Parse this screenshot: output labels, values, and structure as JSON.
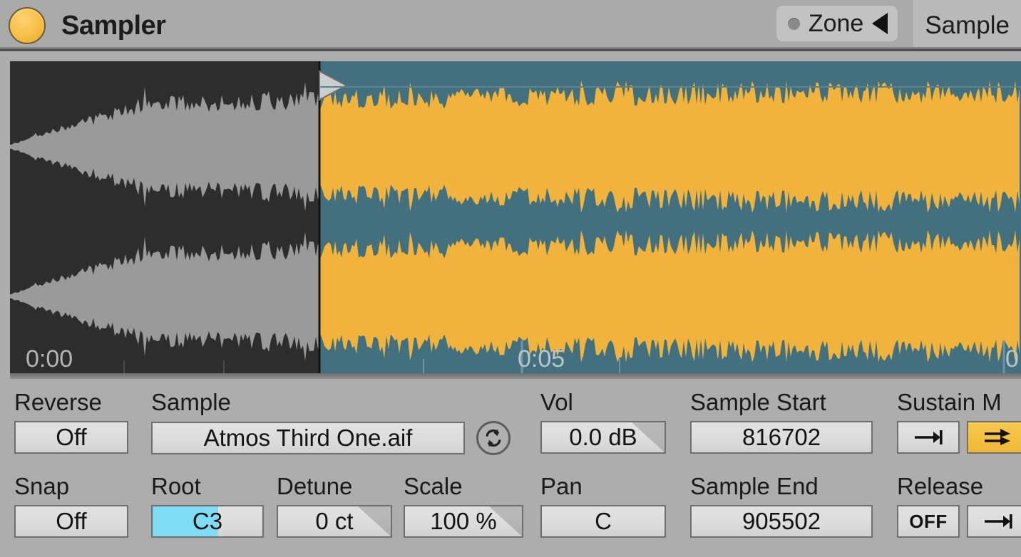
{
  "header": {
    "device_title": "Sampler",
    "activator_label": "device-on",
    "zone_button": {
      "label": "Zone",
      "icon": "triangle-left-icon",
      "dot": "status-dot"
    },
    "tab": {
      "label": "Sample"
    }
  },
  "waveform": {
    "time_labels": [
      "0:00",
      "0:05",
      "0"
    ],
    "selection_start_marker": "sample-start-marker",
    "colors": {
      "unselected_bg": "#2d2d2d",
      "unselected_wave": "#9a9a9a",
      "selected_bg": "#42707e",
      "selected_wave": "#f2b33c"
    }
  },
  "controls": {
    "reverse": {
      "label": "Reverse",
      "value": "Off"
    },
    "snap": {
      "label": "Snap",
      "value": "Off"
    },
    "sample": {
      "label": "Sample",
      "value": "Atmos Third One.aif",
      "reload_icon": "reload-sample-icon"
    },
    "root": {
      "label": "Root",
      "value": "C3",
      "fill_percent": 60
    },
    "detune": {
      "label": "Detune",
      "value": "0 ct"
    },
    "scale": {
      "label": "Scale",
      "value": "100 %"
    },
    "vol": {
      "label": "Vol",
      "value": "0.0 dB"
    },
    "pan": {
      "label": "Pan",
      "value": "C"
    },
    "sample_start": {
      "label": "Sample Start",
      "value": "816702"
    },
    "sample_end": {
      "label": "Sample End",
      "value": "905502"
    },
    "sustain_mode": {
      "label": "Sustain M",
      "button_a_icon": "arrow-to-bar-icon",
      "button_b_icon": "loop-forward-icon",
      "button_b_active": true
    },
    "release_mode": {
      "label": "Release",
      "button_a_label": "OFF",
      "button_b_icon": "arrow-to-bar-icon"
    }
  }
}
